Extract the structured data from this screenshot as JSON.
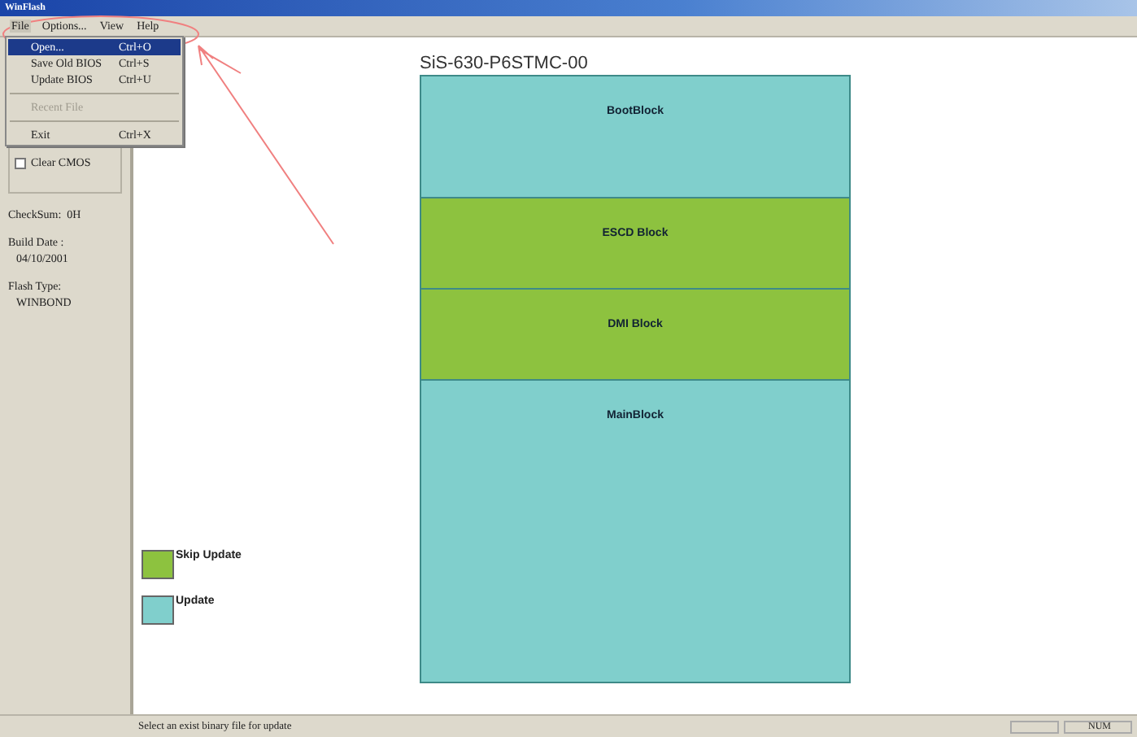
{
  "window": {
    "title": "WinFlash"
  },
  "menu_bar": [
    {
      "label": "File",
      "selected": true
    },
    {
      "label": "Options...",
      "selected": false
    },
    {
      "label": "View",
      "selected": false
    },
    {
      "label": "Help",
      "selected": false
    }
  ],
  "file_menu": [
    {
      "kind": "item",
      "label": "Open...",
      "shortcut": "Ctrl+O",
      "selected": true,
      "disabled": false
    },
    {
      "kind": "item",
      "label": "Save Old BIOS",
      "shortcut": "Ctrl+S",
      "selected": false,
      "disabled": false
    },
    {
      "kind": "item",
      "label": "Update BIOS",
      "shortcut": "Ctrl+U",
      "selected": false,
      "disabled": false
    },
    {
      "kind": "separator"
    },
    {
      "kind": "item",
      "label": "Recent File",
      "selected": false,
      "disabled": true
    },
    {
      "kind": "separator"
    },
    {
      "kind": "item",
      "label": "Exit",
      "shortcut": "Ctrl+X",
      "selected": false,
      "disabled": false
    }
  ],
  "left_panel": {
    "clear_cmos": {
      "label": "Clear CMOS",
      "checked": false
    },
    "info": [
      {
        "kind": "inline",
        "label": "CheckSum:",
        "value": "0H"
      },
      {
        "kind": "stacked",
        "label": "Build Date :",
        "value": "04/10/2001"
      },
      {
        "kind": "stacked",
        "label": "Flash Type:",
        "value": "WINBOND"
      }
    ]
  },
  "chip_title": "SiS-630-P6STMC-00",
  "blocks": [
    {
      "name": "BootBlock",
      "color": "#80cfcc"
    },
    {
      "name": "ESCD Block",
      "color": "#8dc23f"
    },
    {
      "name": "DMI Block",
      "color": "#8dc23f"
    },
    {
      "name": "MainBlock",
      "color": "#80cfcc"
    }
  ],
  "legend": [
    {
      "label": "Skip Update",
      "color": "#8dc23f"
    },
    {
      "label": "Update",
      "color": "#80cfcc"
    }
  ],
  "status_bar": {
    "message": "Select an exist binary file for update",
    "indicator": "NUM"
  }
}
